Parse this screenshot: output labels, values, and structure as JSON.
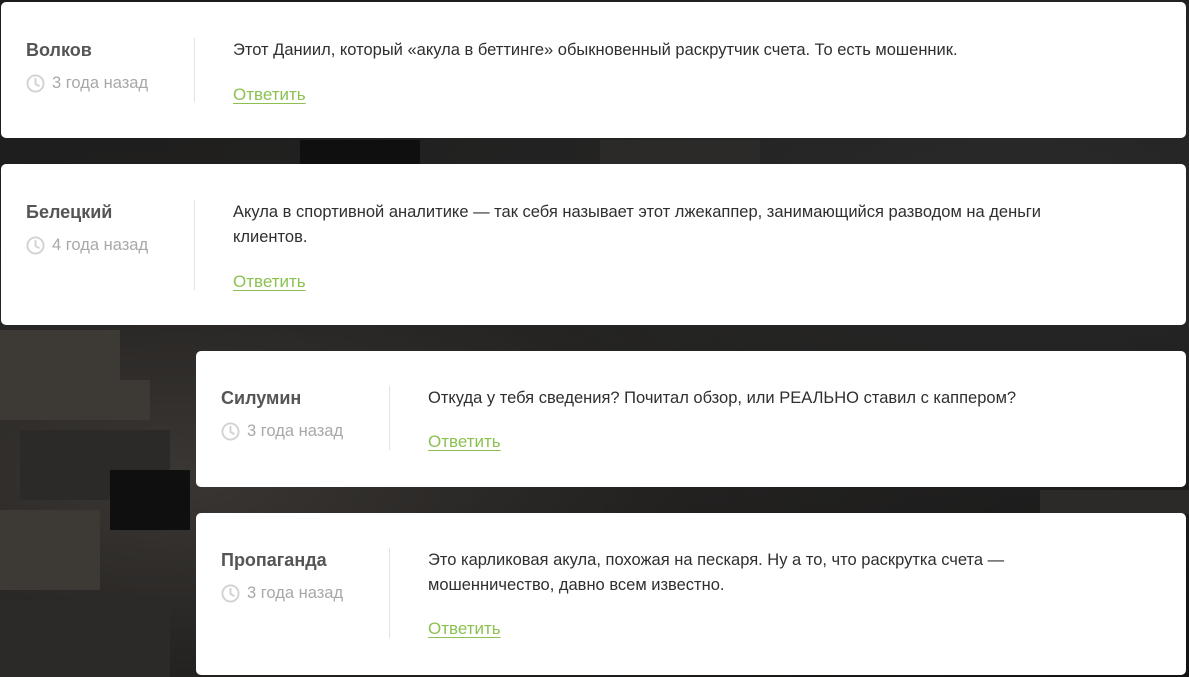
{
  "comments": [
    {
      "author": "Волков",
      "time": "3 года назад",
      "text": "Этот Даниил, который «акула в беттинге» обыкновенный раскрутчик счета. То есть мошенник.",
      "reply_label": "Ответить"
    },
    {
      "author": "Белецкий",
      "time": "4 года назад",
      "text": "Акула в спортивной аналитике — так себя называет этот лжекаппер, занимающийся разводом на деньги клиентов.",
      "reply_label": "Ответить"
    },
    {
      "author": "Силумин",
      "time": "3 года назад",
      "text": "Откуда у тебя сведения? Почитал обзор, или РЕАЛЬНО ставил с каппером?",
      "reply_label": "Ответить"
    },
    {
      "author": "Пропаганда",
      "time": "3 года назад",
      "text": "Это карликовая акула, похожая на пескаря. Ну а то, что раскрутка счета — мошенничество, давно всем известно.",
      "reply_label": "Ответить"
    }
  ],
  "colors": {
    "accent_link": "#8cc152",
    "author_text": "#555555",
    "meta_text": "#a8a8a8",
    "card_bg": "#ffffff"
  },
  "icons": {
    "time": "clock-icon"
  }
}
